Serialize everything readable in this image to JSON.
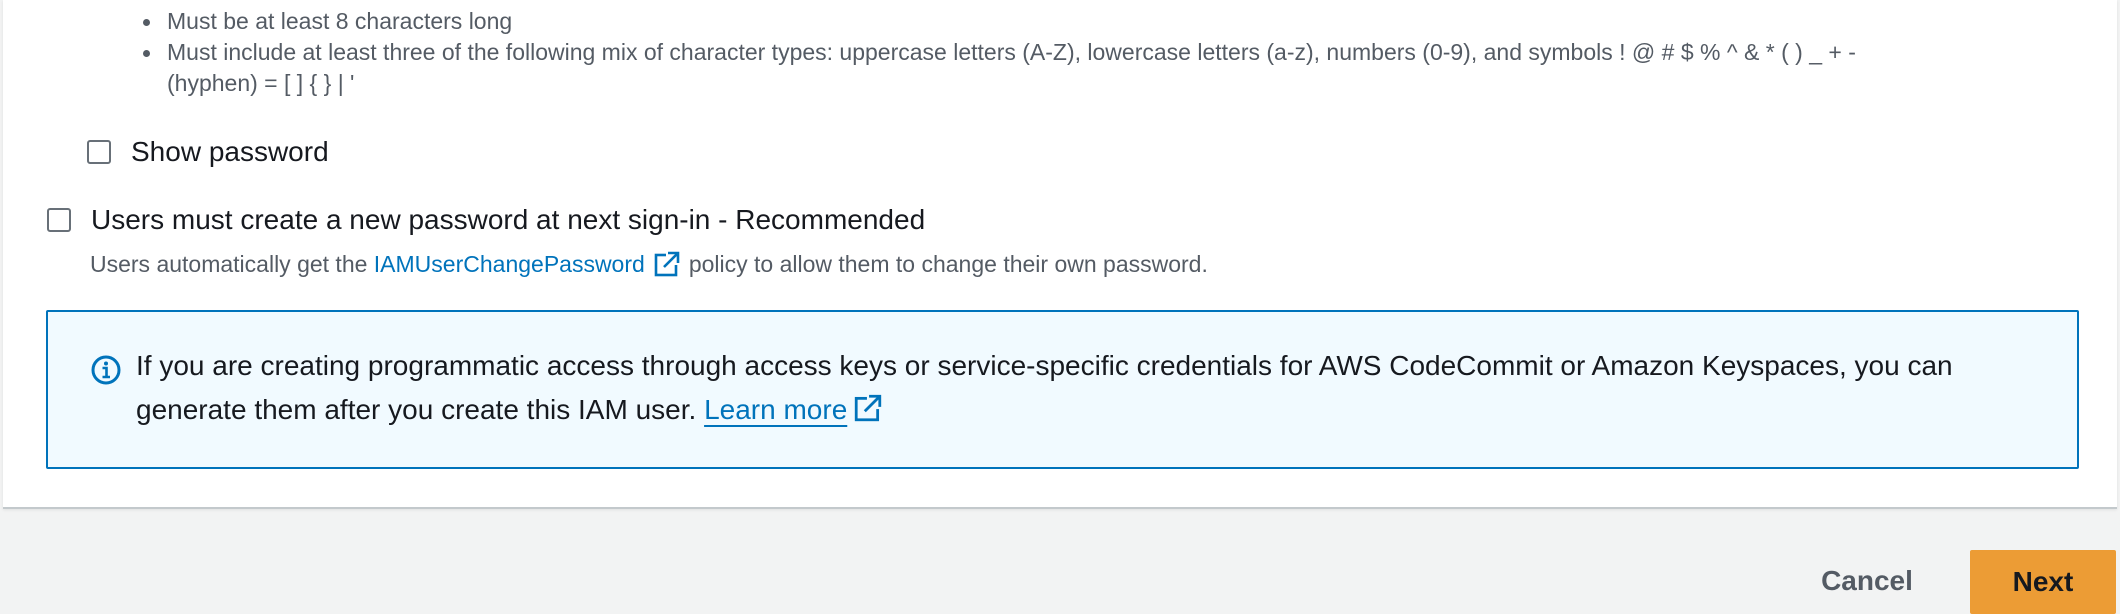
{
  "password_requirements": [
    "Must be at least 8 characters long",
    "Must include at least three of the following mix of character types: uppercase letters (A-Z), lowercase letters (a-z), numbers (0-9), and symbols ! @ # $ % ^ & * ( ) _ + -",
    "(hyphen) = [ ] { } | '"
  ],
  "show_password": {
    "label": "Show password",
    "checked": false
  },
  "require_reset": {
    "label": "Users must create a new password at next sign-in - Recommended",
    "checked": false,
    "description_prefix": "Users automatically get the",
    "policy_link": "IAMUserChangePassword",
    "description_suffix": "policy to allow them to change their own password."
  },
  "info_alert": {
    "text": "If you are creating programmatic access through access keys or service-specific credentials for AWS CodeCommit or Amazon Keyspaces, you can generate them after you create this IAM user.",
    "link": "Learn more",
    "icon": "info-icon"
  },
  "footer": {
    "cancel_label": "Cancel",
    "next_label": "Next"
  },
  "colors": {
    "link": "#0073bb",
    "primary_button": "#ec9c35",
    "alert_background": "#f1faff",
    "alert_border": "#0073bb"
  }
}
